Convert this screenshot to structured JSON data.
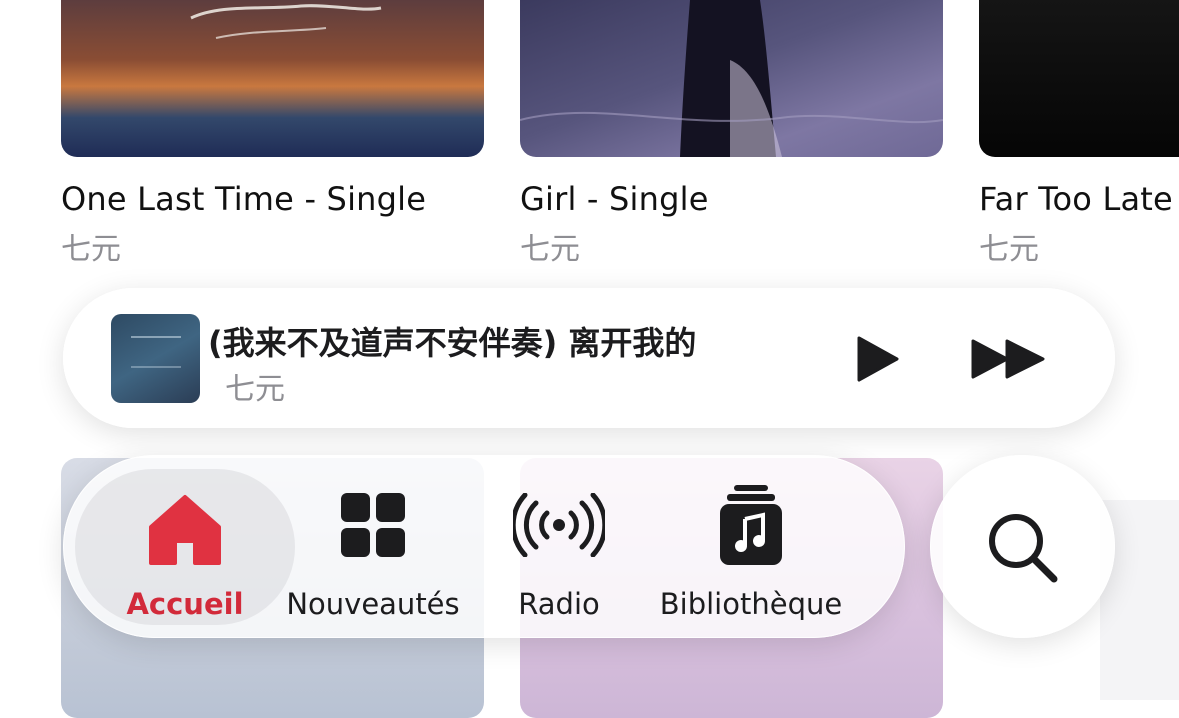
{
  "albums": [
    {
      "title": "One Last Time - Single",
      "subtitle": "七元"
    },
    {
      "title": "Girl - Single",
      "subtitle": "七元"
    },
    {
      "title": "Far Too Late",
      "subtitle": "七元"
    }
  ],
  "now_playing": {
    "title": "(我来不及道声不安伴奏)         离开我的",
    "artist": "七元"
  },
  "tabs": {
    "home": "Accueil",
    "new": "Nouveautés",
    "radio": "Radio",
    "library": "Bibliothèque"
  },
  "icons": {
    "home": "house-icon",
    "new": "grid-icon",
    "radio": "broadcast-icon",
    "library": "music-library-icon",
    "search": "magnifier-icon",
    "play": "play-icon",
    "next": "fast-forward-icon"
  },
  "colors": {
    "accent": "#d22a3a",
    "icon": "#1c1c1e",
    "subtitle": "#8e8e93"
  }
}
